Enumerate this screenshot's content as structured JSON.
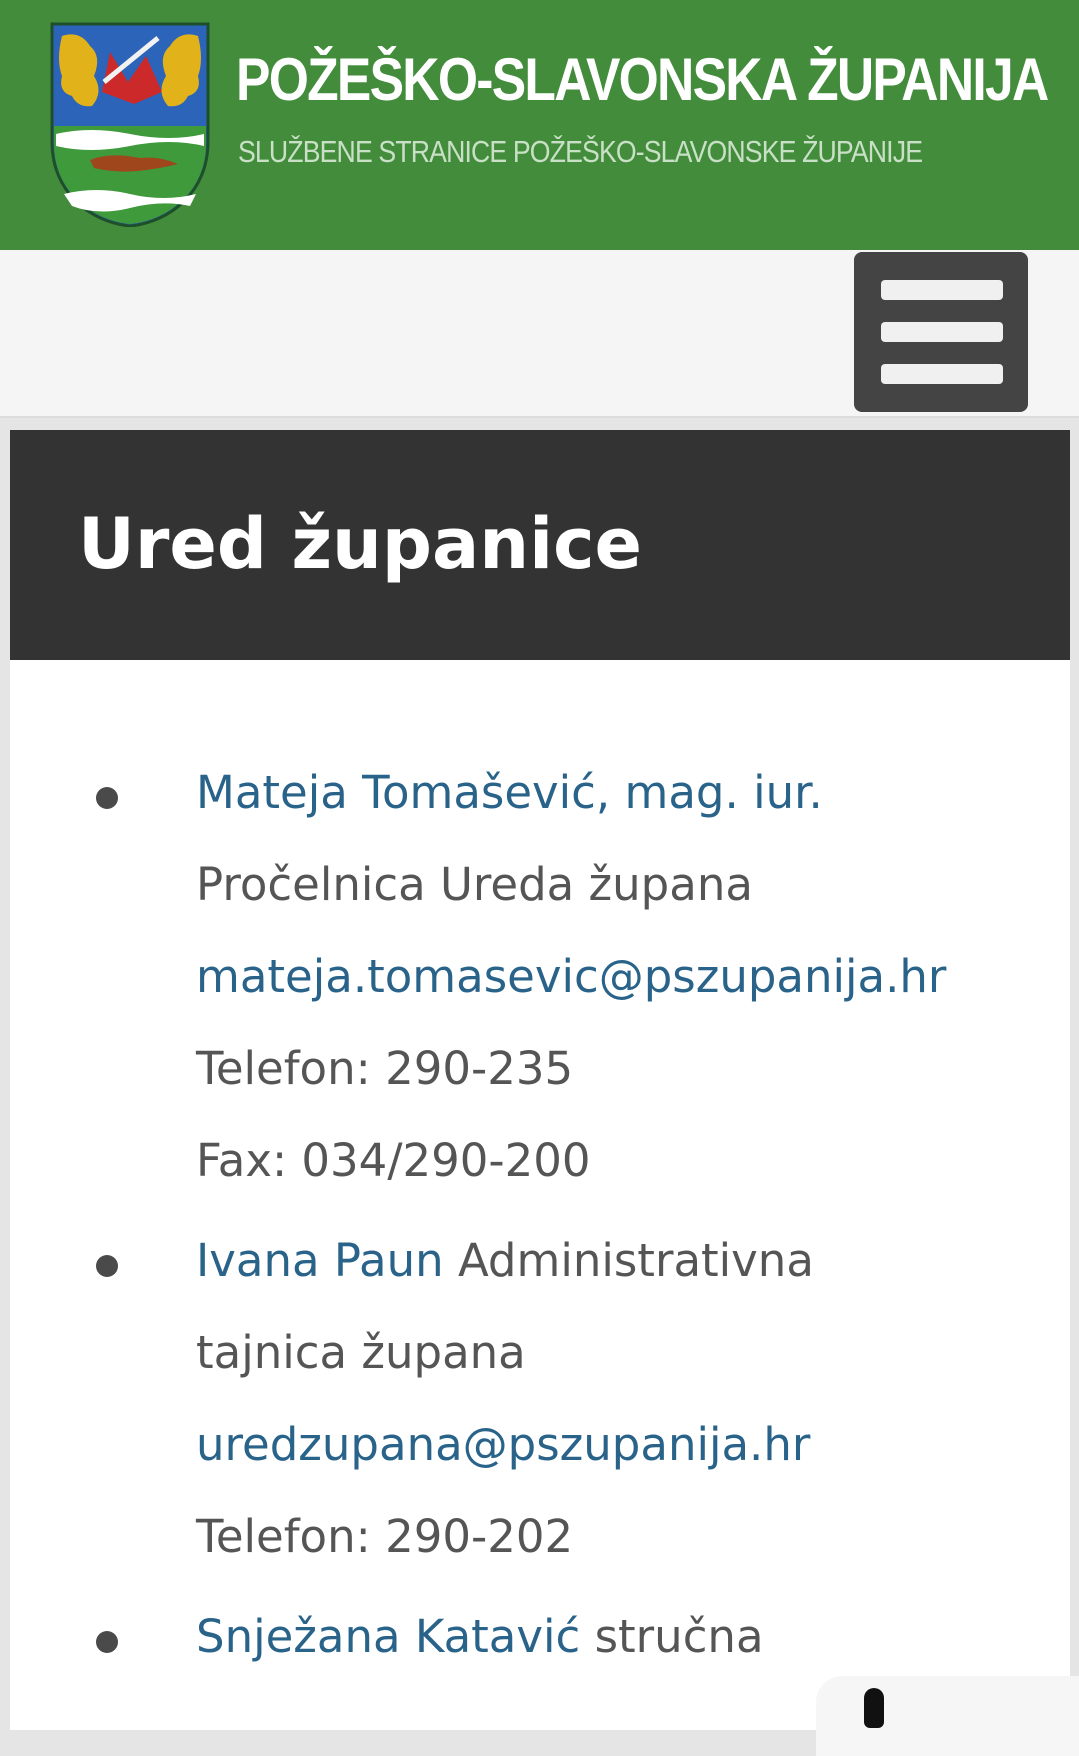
{
  "header": {
    "title": "POŽEŠKO-SLAVONSKA ŽUPANIJA",
    "subtitle": "SLUŽBENE STRANICE POŽEŠKO-SLAVONSKE ŽUPANIJE",
    "logo_icon": "coat-of-arms-icon"
  },
  "nav": {
    "menu_icon": "hamburger-menu-icon"
  },
  "page": {
    "title": "Ured županice"
  },
  "staff": [
    {
      "name": "Mateja Tomašević, mag. iur.",
      "role": "Pročelnica Ureda župana",
      "email": "mateja.tomasevic@pszupanija.hr",
      "phone": "Telefon: 290-235",
      "fax": "Fax: 034/290-200"
    },
    {
      "name": "Ivana Paun",
      "role_part1": "Administrativna",
      "role_part2": "tajnica župana",
      "email": "uredzupana@pszupanija.hr",
      "phone": "Telefon: 290-202"
    },
    {
      "name": "Snježana Katavić",
      "role_part1": "stručna"
    }
  ],
  "colors": {
    "header_bg": "#438c3c",
    "panel_head_bg": "#333333",
    "link": "#2a6389",
    "text": "#555555"
  }
}
